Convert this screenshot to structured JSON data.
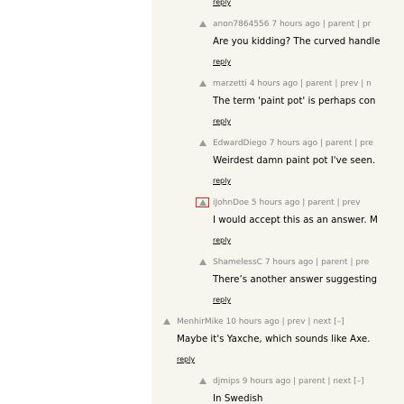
{
  "thread": {
    "top_reply": "reply",
    "comments": [
      {
        "user": "anon7864556",
        "age": "7 hours ago",
        "links": [
          "parent",
          "pr"
        ],
        "text": "Are you kidding? The curved handle",
        "reply": "reply"
      },
      {
        "user": "marzetti",
        "age": "4 hours ago",
        "links": [
          "parent",
          "prev",
          "n"
        ],
        "text": "The term 'paint pot' is perhaps con",
        "reply": "reply"
      },
      {
        "user": "EdwardDiego",
        "age": "7 hours ago",
        "links": [
          "parent",
          "pre"
        ],
        "text": "Weirdest damn paint pot I've seen.",
        "reply": "reply"
      },
      {
        "user": "iJohnDoe",
        "age": "5 hours ago",
        "links": [
          "parent",
          "prev"
        ],
        "text": "I would accept this as an answer. M",
        "reply": "reply"
      },
      {
        "user": "ShamelessC",
        "age": "7 hours ago",
        "links": [
          "parent",
          "pre"
        ],
        "text": "There’s another answer suggesting",
        "reply": "reply"
      },
      {
        "user": "MenhirMike",
        "age": "10 hours ago",
        "links": [
          "prev",
          "next [–]"
        ],
        "text": "Maybe it's Yaxche, which sounds like Axe.",
        "reply": "reply"
      },
      {
        "user": "djmips",
        "age": "9 hours ago",
        "links": [
          "parent",
          "next [–]"
        ],
        "text": "In Swedish",
        "reply": ""
      }
    ],
    "sep": "|"
  },
  "colors": {
    "background": "#f6f6ef",
    "meta": "#828282",
    "focus": "#e02020"
  }
}
